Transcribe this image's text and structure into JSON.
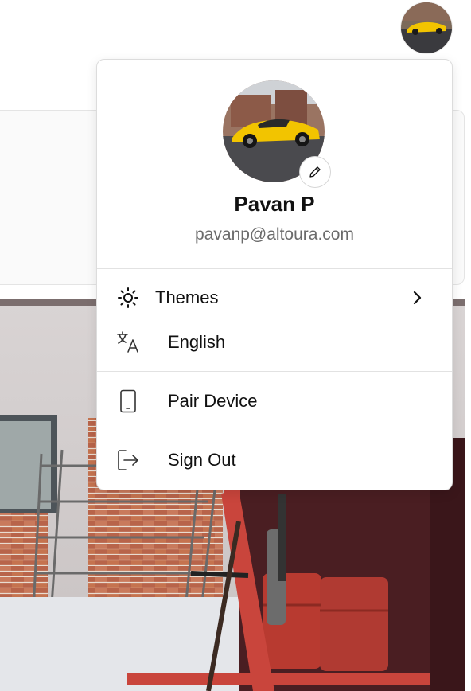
{
  "profile": {
    "name": "Pavan P",
    "email": "pavanp@altoura.com"
  },
  "menu": {
    "themes_label": "Themes",
    "language_label": "English",
    "pair_device_label": "Pair Device",
    "sign_out_label": "Sign Out"
  },
  "icons": {
    "themes": "sun-icon",
    "language": "translate-icon",
    "pair_device": "tablet-icon",
    "sign_out": "sign-out-icon",
    "submenu": "chevron-right-icon",
    "edit": "pencil-icon"
  },
  "colors": {
    "car": "#f2c400",
    "text_muted": "#6b6b6b"
  }
}
